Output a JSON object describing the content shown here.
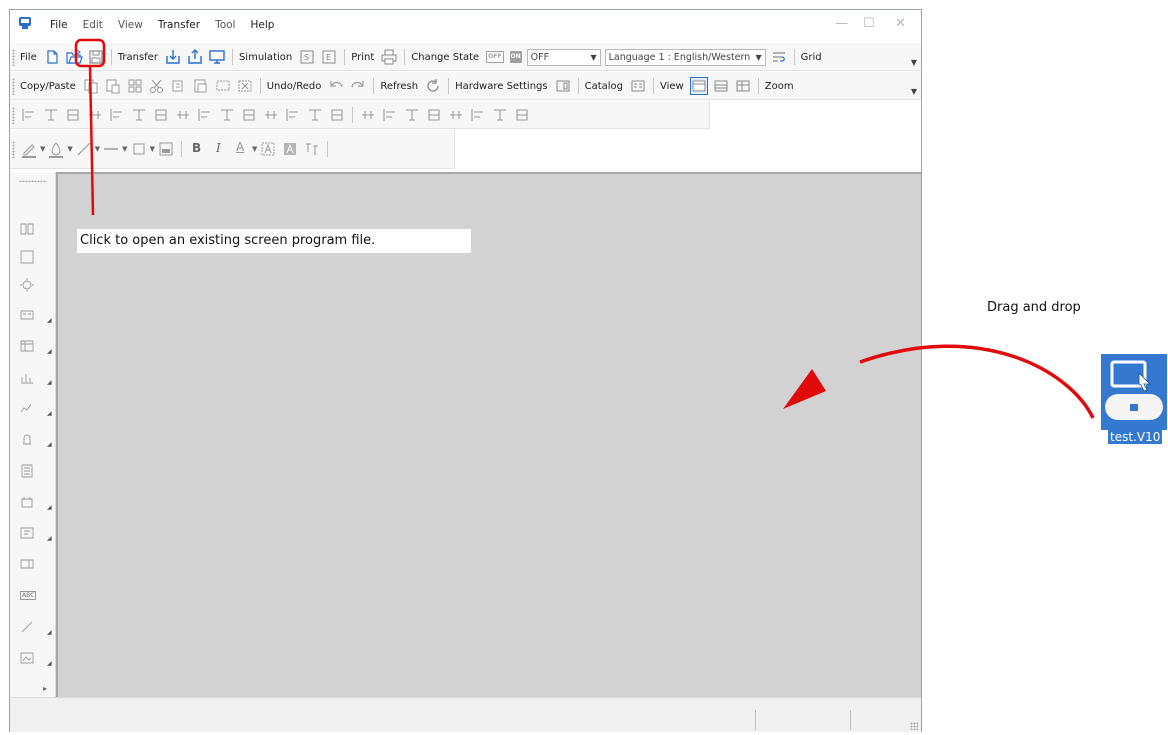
{
  "menu": {
    "items": [
      "File",
      "Edit",
      "View",
      "Transfer",
      "Tool",
      "Help"
    ]
  },
  "window_controls": {
    "minimize": "—",
    "maximize": "☐",
    "close": "✕"
  },
  "toolbar1": {
    "file_label": "File",
    "transfer_label": "Transfer",
    "simulation_label": "Simulation",
    "print_label": "Print",
    "change_state_label": "Change State",
    "off_badge": "OFF",
    "on_badge": "ON",
    "state_value": "OFF",
    "language_value": "Language 1 : English/Western",
    "grid_label": "Grid"
  },
  "toolbar2": {
    "copy_paste_label": "Copy/Paste",
    "undo_redo_label": "Undo/Redo",
    "refresh_label": "Refresh",
    "hardware_settings_label": "Hardware Settings",
    "catalog_label": "Catalog",
    "view_label": "View",
    "zoom_label": "Zoom"
  },
  "toolbar4": {
    "bold_label": "B",
    "italic_label": "I",
    "font_color_label": "A"
  },
  "left_panel": {
    "text_item_label": "ABC"
  },
  "desktop": {
    "file_name": "test.V10"
  },
  "annotations": {
    "open_file_callout": "Click to open an existing screen program file.",
    "drag_drop_label": "Drag and drop"
  },
  "colors": {
    "annotation_red": "#e10a0a",
    "canvas_gray": "#d2d2d2",
    "accent_blue": "#2a6fc9"
  }
}
